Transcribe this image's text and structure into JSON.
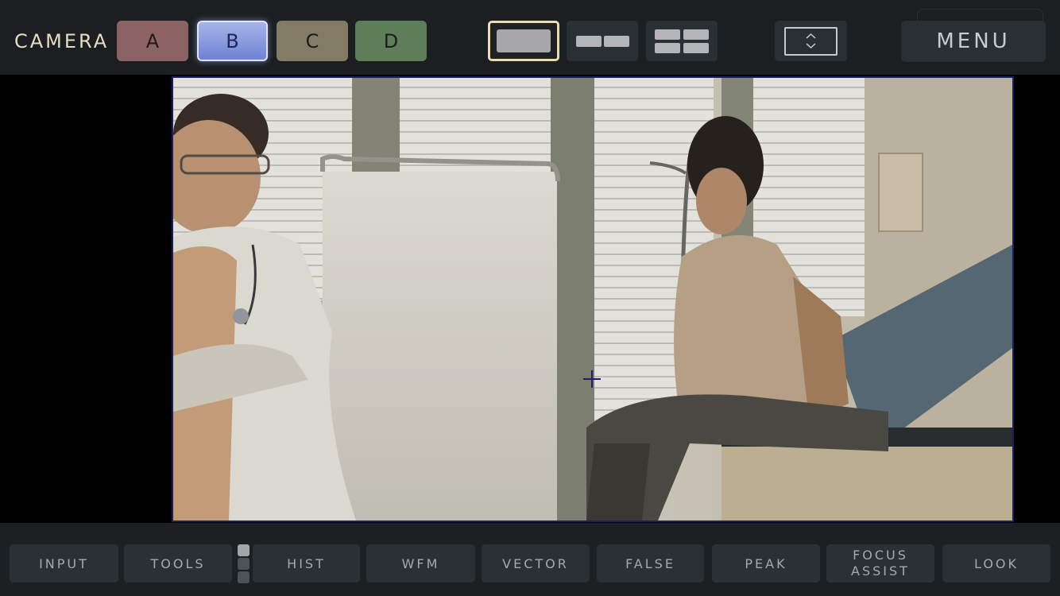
{
  "header": {
    "camera_label": "CAMERA",
    "cameras": [
      {
        "label": "A",
        "color": "#8c6264",
        "selected": false
      },
      {
        "label": "B",
        "color": "#8a9ade",
        "selected": true
      },
      {
        "label": "C",
        "color": "#847b66",
        "selected": false
      },
      {
        "label": "D",
        "color": "#5e7e59",
        "selected": false
      }
    ],
    "layouts": [
      {
        "icon": "single-view-icon",
        "selected": true
      },
      {
        "icon": "dual-view-icon",
        "selected": false
      },
      {
        "icon": "quad-view-icon",
        "selected": false
      }
    ],
    "expand_icon": "expand-collapse-icon",
    "menu_label": "MENU"
  },
  "viewer": {
    "overlay": "crosshair-icon"
  },
  "toolbar": {
    "items": [
      {
        "label": "INPUT"
      },
      {
        "label": "TOOLS"
      },
      {
        "label": "HIST"
      },
      {
        "label": "WFM"
      },
      {
        "label": "VECTOR"
      },
      {
        "label": "FALSE"
      },
      {
        "label": "PEAK"
      },
      {
        "label": "FOCUS",
        "label2": "ASSIST"
      },
      {
        "label": "LOOK"
      }
    ],
    "pager": {
      "pages": 3,
      "current": 1
    }
  },
  "colors": {
    "accent_selected_outline": "#ecdcb0",
    "top_bar": "#1b1f22",
    "button_bg": "#2a2f33"
  }
}
